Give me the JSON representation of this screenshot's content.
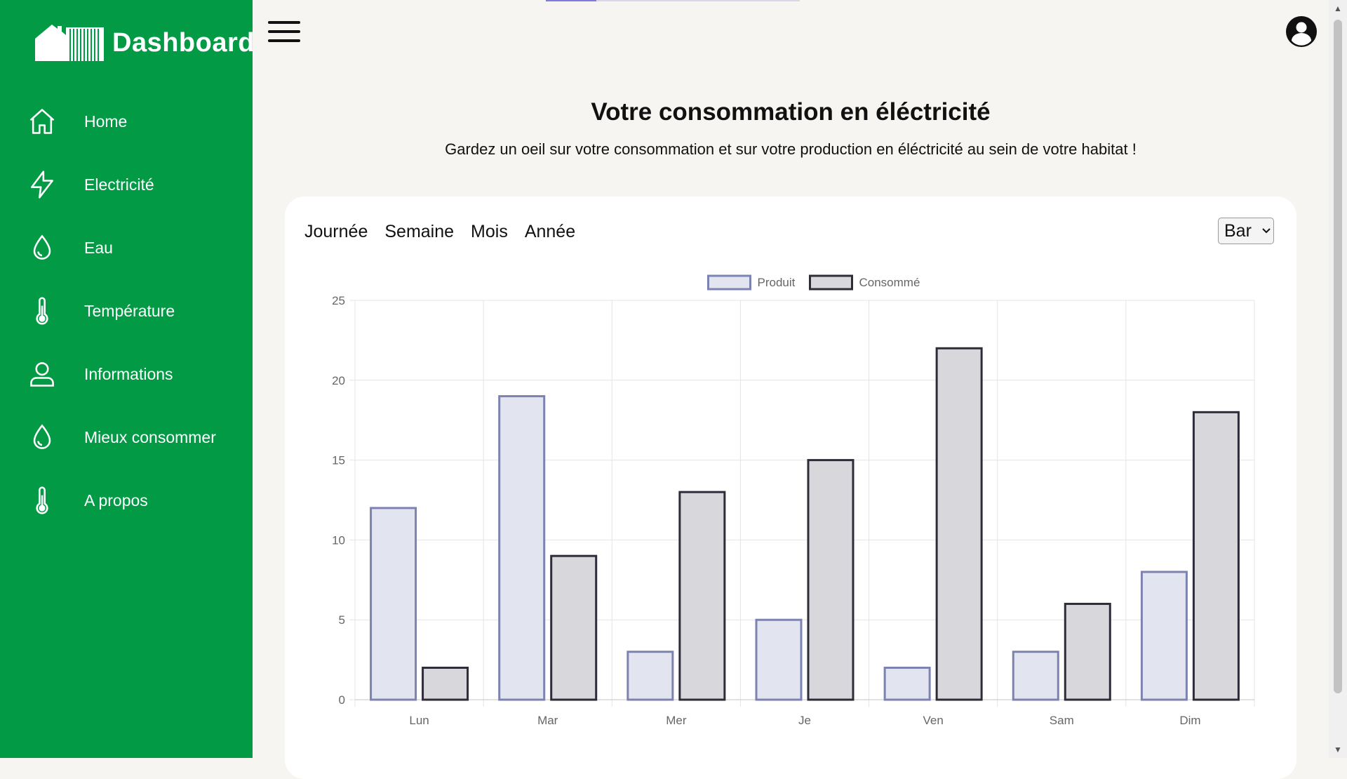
{
  "brand": {
    "title": "Dashboard",
    "icon": "house-building-logo"
  },
  "sidebar": {
    "items": [
      {
        "label": "Home",
        "icon": "home-icon"
      },
      {
        "label": "Electricité",
        "icon": "lightning-icon"
      },
      {
        "label": "Eau",
        "icon": "water-drop-icon"
      },
      {
        "label": "Température",
        "icon": "thermometer-icon"
      },
      {
        "label": "Informations",
        "icon": "user-icon"
      },
      {
        "label": "Mieux consommer",
        "icon": "water-drop-icon"
      },
      {
        "label": "A propos",
        "icon": "thermometer-icon"
      }
    ]
  },
  "topbar": {
    "menu_icon": "hamburger-icon",
    "avatar_icon": "user-circle-icon",
    "progress": 0.2
  },
  "main": {
    "title": "Votre consommation en éléctricité",
    "subtitle": "Gardez un oeil sur votre consommation et sur votre production en éléctricité au sein de votre habitat !",
    "tabs": [
      {
        "label": "Journée"
      },
      {
        "label": "Semaine"
      },
      {
        "label": "Mois"
      },
      {
        "label": "Année"
      }
    ],
    "chart_type_select": {
      "value": "Bar",
      "options": [
        "Bar"
      ]
    }
  },
  "colors": {
    "sidebar_bg": "#029a45",
    "page_bg": "#f7f5f1",
    "produit_fill": "#e2e4ef",
    "produit_border": "#7c83b0",
    "consomme_fill": "#d8d7db",
    "consomme_border": "#2f2c3a"
  },
  "chart_data": {
    "type": "bar",
    "categories": [
      "Lun",
      "Mar",
      "Mer",
      "Je",
      "Ven",
      "Sam",
      "Dim"
    ],
    "series": [
      {
        "name": "Produit",
        "values": [
          12,
          19,
          3,
          5,
          2,
          3,
          8
        ]
      },
      {
        "name": "Consommé",
        "values": [
          2,
          9,
          13,
          15,
          22,
          6,
          18
        ]
      }
    ],
    "ylim": [
      0,
      25
    ],
    "yticks": [
      0,
      5,
      10,
      15,
      20,
      25
    ],
    "legend": "top-center",
    "grid": true
  }
}
